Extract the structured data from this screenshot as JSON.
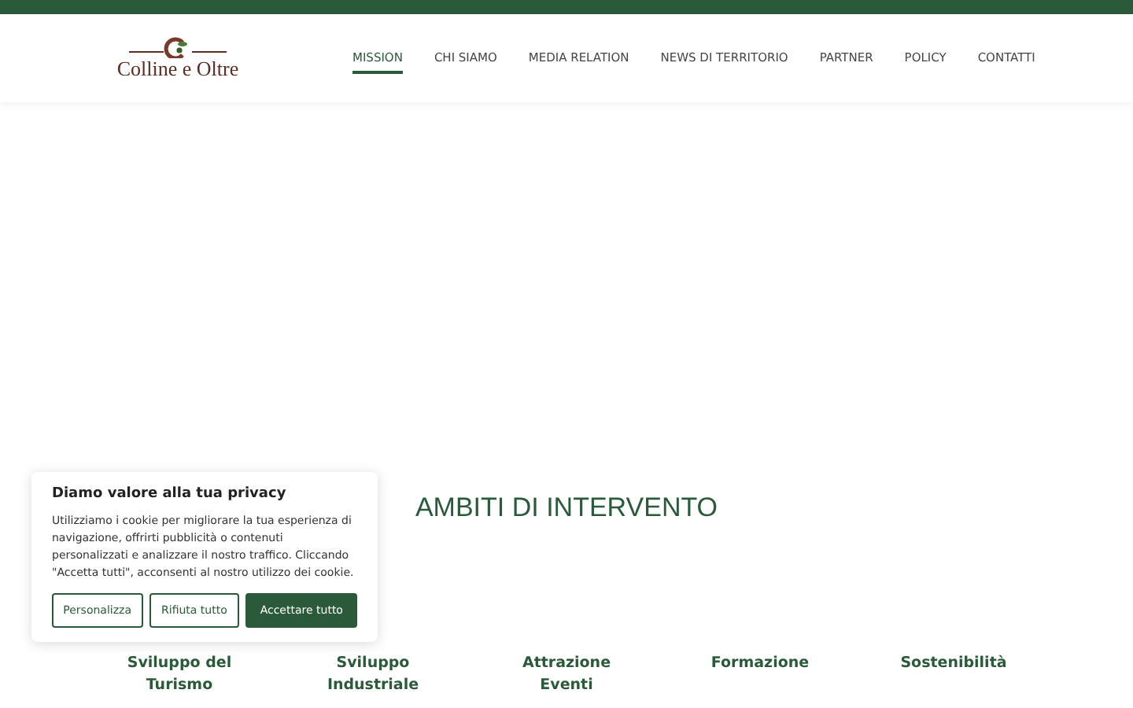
{
  "logo": {
    "text": "Colline e Oltre"
  },
  "nav": [
    {
      "label": "MISSION",
      "selected": true
    },
    {
      "label": "CHI SIAMO",
      "selected": false
    },
    {
      "label": "MEDIA RELATION",
      "selected": false
    },
    {
      "label": "NEWS DI TERRITORIO",
      "selected": false
    },
    {
      "label": "PARTNER",
      "selected": false
    },
    {
      "label": "POLICY",
      "selected": false
    },
    {
      "label": "CONTATTI",
      "selected": false
    }
  ],
  "section": {
    "title": "AMBITI DI INTERVENTO"
  },
  "areas": [
    {
      "lines": [
        "Sviluppo del",
        "Turismo"
      ]
    },
    {
      "lines": [
        "Sviluppo",
        "Industriale"
      ]
    },
    {
      "lines": [
        "Attrazione",
        "Eventi"
      ]
    },
    {
      "lines": [
        "Formazione"
      ]
    },
    {
      "lines": [
        "Sostenibilità"
      ]
    }
  ],
  "cookie_banner": {
    "title": "Diamo valore alla tua privacy",
    "text": "Utilizziamo i cookie per migliorare la tua esperienza di navigazione, offrirti pubblicità o contenuti personalizzati e analizzare il nostro traffico. Cliccando \"Accetta tutti\", acconsenti al nostro utilizzo dei cookie.",
    "buttons": [
      {
        "label": "Personalizza",
        "kind": "outline"
      },
      {
        "label": "Rifiuta tutto",
        "kind": "outline"
      },
      {
        "label": "Accettare tutto",
        "kind": "primary"
      }
    ]
  }
}
